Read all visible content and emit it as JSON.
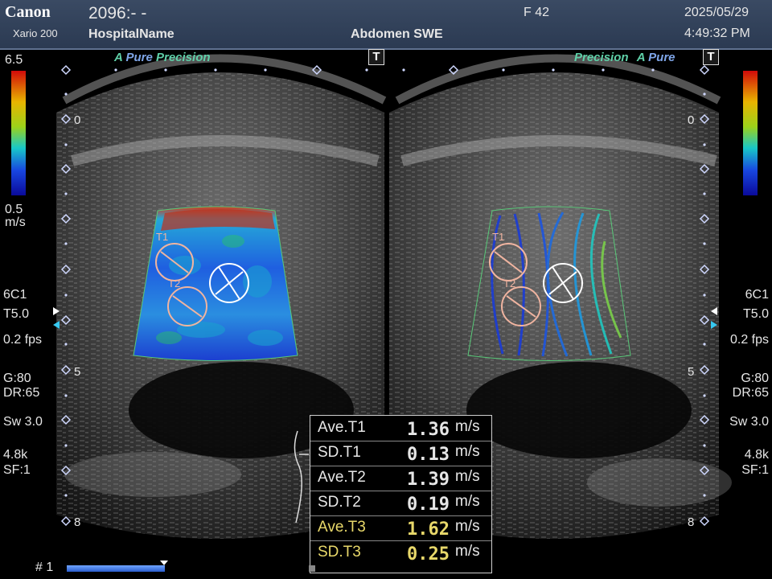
{
  "header": {
    "brand": "Canon",
    "model": "Xario 200",
    "patient_id": "2096:- -",
    "hospital": "HospitalName",
    "exam": "Abdomen SWE",
    "frame_rate_label": "F 42",
    "date": "2025/05/29",
    "time": "4:49:32 PM"
  },
  "left_panel": {
    "scale_max": "6.5",
    "scale_min": "0.5",
    "scale_unit": "m/s",
    "probe": "6C1",
    "transmit": "T5.0",
    "fps": "0.2 fps",
    "gain": "G:80",
    "dynamic_range": "DR:65",
    "sweep": "Sw 3.0",
    "prf": "4.8k",
    "sf": "SF:1"
  },
  "right_panel": {
    "probe": "6C1",
    "transmit": "T5.0",
    "fps": "0.2 fps",
    "gain": "G:80",
    "dynamic_range": "DR:65",
    "sweep": "Sw 3.0",
    "prf": "4.8k",
    "sf": "SF:1"
  },
  "images": {
    "left_title_a": "A",
    "left_title_pure": "Pure",
    "left_title_precision": "Precision",
    "right_title_precision": "Precision",
    "right_title_a": "A",
    "right_title_pure": "Pure",
    "t_button": "T",
    "depth_0": "0",
    "depth_5": "5",
    "depth_8": "8",
    "roi_t1": "T1",
    "roi_t2": "T2"
  },
  "measurements": [
    {
      "label": "Ave.T1",
      "value": "1.36",
      "unit": "m/s"
    },
    {
      "label": "SD.T1",
      "value": "0.13",
      "unit": "m/s"
    },
    {
      "label": "Ave.T2",
      "value": "1.39",
      "unit": "m/s"
    },
    {
      "label": "SD.T2",
      "value": "0.19",
      "unit": "m/s"
    },
    {
      "label": "Ave.T3",
      "value": "1.62",
      "unit": "m/s"
    },
    {
      "label": "SD.T3",
      "value": "0.25",
      "unit": "m/s"
    }
  ],
  "footer": {
    "frame_number": "# 1"
  },
  "colors": {
    "header_bg": "#33445e",
    "title_green": "#5fd0a8",
    "title_blue": "#7fa6e8",
    "highlight_yellow": "#e8d86a",
    "roi_circle": "#f0b4a0",
    "roi_t3": "#ffffff"
  }
}
